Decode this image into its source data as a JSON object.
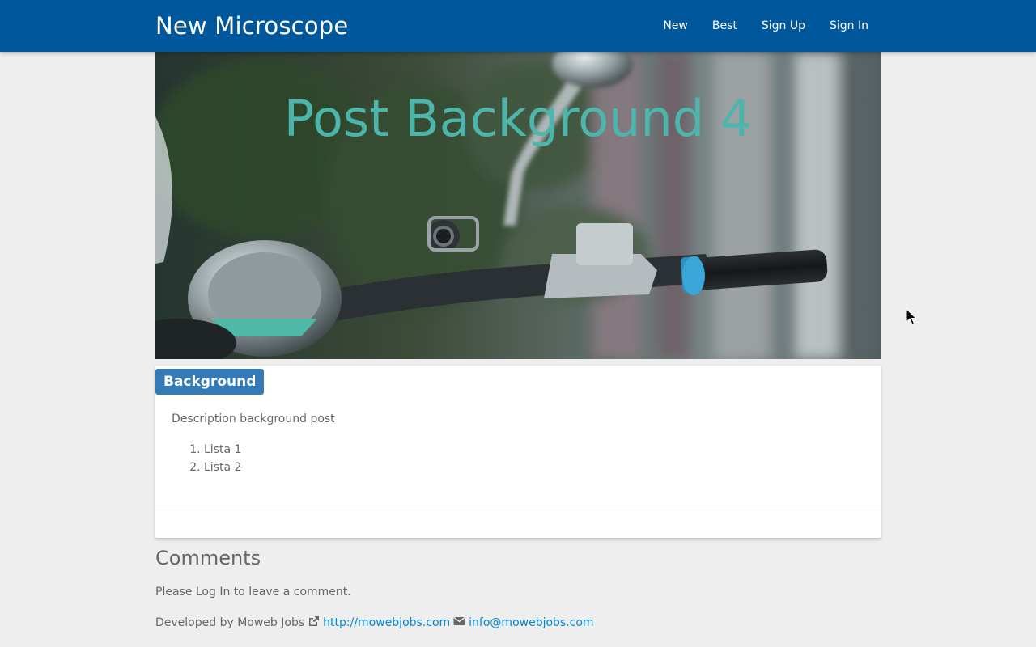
{
  "navbar": {
    "brand": "New Microscope",
    "links": [
      "New",
      "Best",
      "Sign Up",
      "Sign In"
    ],
    "background_color": "#01579b"
  },
  "post": {
    "title": "Post Background 4",
    "title_color": "#4db6ac",
    "category": "Background",
    "category_color": "#337ab7",
    "description": "Description background post",
    "list_items": [
      "Lista 1",
      "Lista 2"
    ]
  },
  "comments": {
    "heading": "Comments",
    "login_prompt": "Please Log In to leave a comment."
  },
  "footer": {
    "developed_by": "Developed by Moweb Jobs",
    "website_icon": "external-link-icon",
    "website": "http://mowebjobs.com",
    "email_icon": "envelope-icon",
    "email": "info@mowebjobs.com",
    "link_color": "#0288d1"
  }
}
